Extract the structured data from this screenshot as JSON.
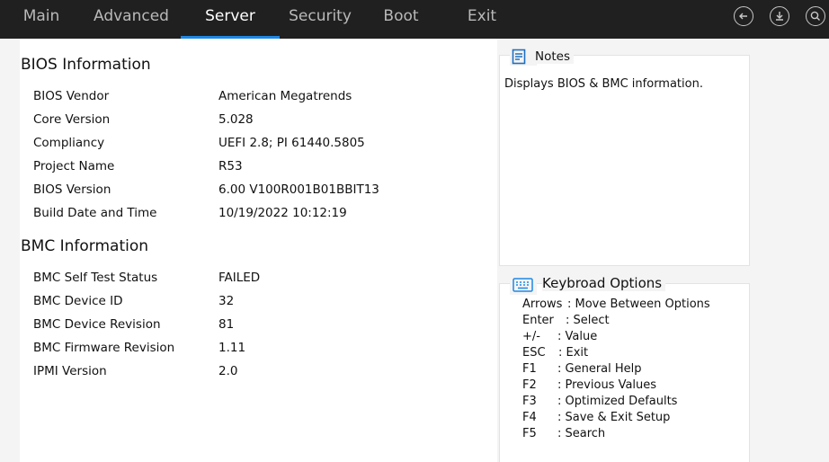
{
  "tabs": [
    {
      "label": "Main",
      "active": false
    },
    {
      "label": "Advanced",
      "active": false
    },
    {
      "label": "Server",
      "active": true
    },
    {
      "label": "Security",
      "active": false
    },
    {
      "label": "Boot",
      "active": false
    },
    {
      "label": "Exit",
      "active": false
    }
  ],
  "top_icons": [
    "back-icon",
    "save-download-icon",
    "search-icon"
  ],
  "bios_info": {
    "title": "BIOS Information",
    "rows": [
      {
        "label": "BIOS Vendor",
        "value": "American Megatrends"
      },
      {
        "label": "Core Version",
        "value": "5.028"
      },
      {
        "label": "Compliancy",
        "value": "UEFI 2.8; PI 61440.5805"
      },
      {
        "label": "Project Name",
        "value": "R53"
      },
      {
        "label": "BIOS Version",
        "value": "6.00 V100R001B01BBIT13"
      },
      {
        "label": "Build Date and Time",
        "value": "10/19/2022 10:12:19"
      }
    ]
  },
  "bmc_info": {
    "title": "BMC Information",
    "rows": [
      {
        "label": "BMC Self Test Status",
        "value": "FAILED"
      },
      {
        "label": "BMC Device ID",
        "value": "32"
      },
      {
        "label": "BMC Device Revision",
        "value": "81"
      },
      {
        "label": "BMC Firmware Revision",
        "value": "1.11"
      },
      {
        "label": "IPMI Version",
        "value": "2.0"
      }
    ]
  },
  "notes": {
    "title": "Notes",
    "text": "Displays BIOS & BMC information."
  },
  "keyboard": {
    "title": "Keybroad Options",
    "items": [
      {
        "key": "Arrows",
        "desc": ": Move Between Options"
      },
      {
        "key": "Enter",
        "desc": ": Select"
      },
      {
        "key": "+/-",
        "desc": ": Value"
      },
      {
        "key": "ESC",
        "desc": ": Exit"
      },
      {
        "key": "F1",
        "desc": ": General Help"
      },
      {
        "key": "F2",
        "desc": ": Previous Values"
      },
      {
        "key": "F3",
        "desc": ": Optimized Defaults"
      },
      {
        "key": "F4",
        "desc": ": Save & Exit Setup"
      },
      {
        "key": "F5",
        "desc": ": Search"
      }
    ]
  },
  "colors": {
    "topbar": "#202020",
    "accent": "#1e88e5",
    "background": "#f4f4f4"
  }
}
